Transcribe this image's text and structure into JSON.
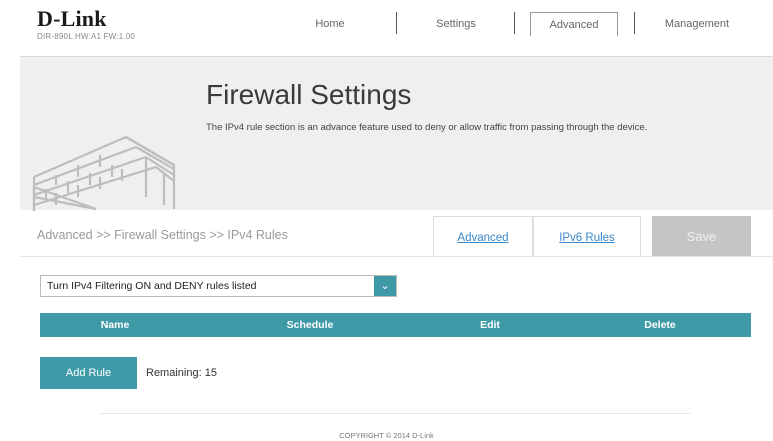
{
  "header": {
    "logo": "D-Link",
    "model_info": "DIR-890L  HW:A1  FW:1.00",
    "nav": [
      "Home",
      "Settings",
      "Advanced",
      "Management"
    ]
  },
  "banner": {
    "title": "Firewall Settings",
    "description": "The IPv4 rule section is an advance feature used to deny or allow traffic from passing through the device."
  },
  "breadcrumb": "Advanced >> Firewall Settings >> IPv4 Rules",
  "tabs": {
    "advanced": "Advanced",
    "ipv6": "IPv6 Rules",
    "save": "Save"
  },
  "filter_mode": {
    "selected": "Turn IPv4 Filtering ON and DENY rules listed"
  },
  "table": {
    "columns": [
      "Name",
      "Schedule",
      "Edit",
      "Delete"
    ]
  },
  "actions": {
    "add_rule": "Add Rule",
    "remaining": "Remaining: 15"
  },
  "footer": {
    "copyright": "COPYRIGHT © 2014 D-Link"
  },
  "colors": {
    "accent": "#3f9aa8",
    "link": "#3b89c9",
    "save_disabled": "#c5c5c5"
  }
}
